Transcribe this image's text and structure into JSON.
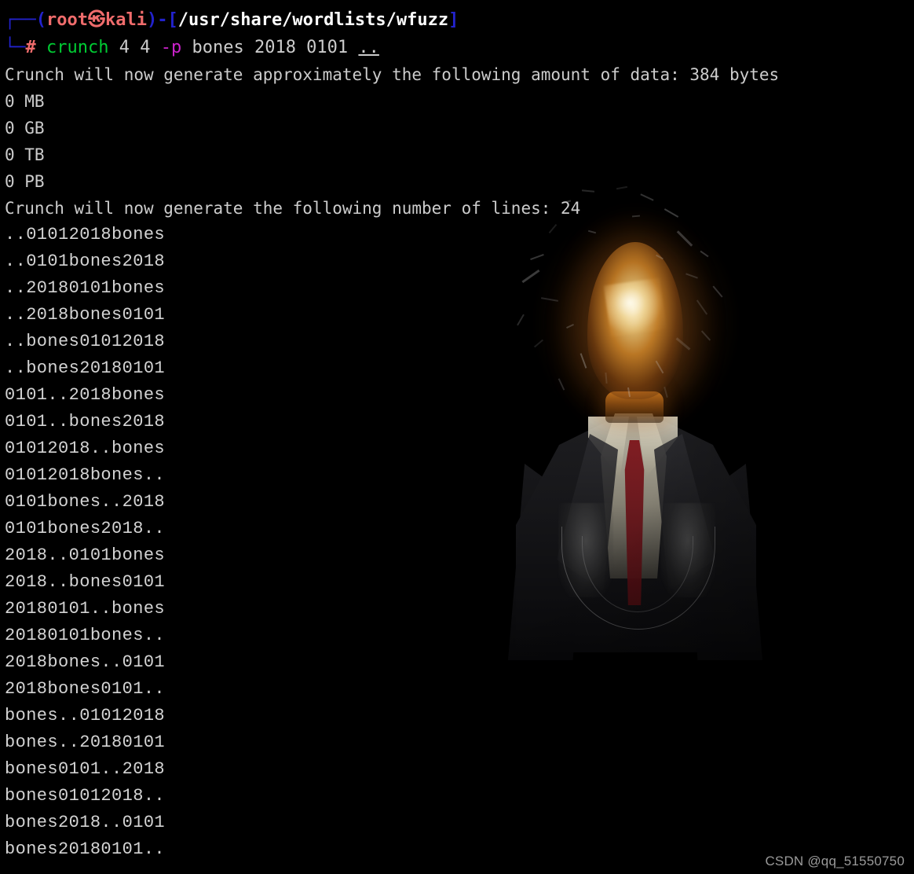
{
  "terminal": {
    "shell": "zsh",
    "background_color": "#000000",
    "foreground_color": "#cccccc",
    "prompt": {
      "top_box": "┌──",
      "bottom_box": "└─",
      "paren_open": "(",
      "user": "root",
      "at_symbol": "㉿",
      "host": "kali",
      "paren_close": ")",
      "dash": "-",
      "bracket_open": "[",
      "path": "/usr/share/wordlists/wfuzz",
      "bracket_close": "]",
      "hash": "#",
      "colors": {
        "box": "#2222cc",
        "user_host": "#f06c6c",
        "brackets": "#2222cc",
        "path": "#ffffff",
        "hash": "#f06c6c",
        "command": "#00cc33",
        "flag": "#cc22cc",
        "args": "#cccccc"
      }
    },
    "command": {
      "name": "crunch",
      "arg_min": "4",
      "arg_max": "4",
      "flag": "-p",
      "pattern_args": "bones 2018 0101",
      "trailing_path": ".."
    },
    "output": {
      "messages": [
        "Crunch will now generate approximately the following amount of data: 384 bytes",
        "0 MB",
        "0 GB",
        "0 TB",
        "0 PB",
        "Crunch will now generate the following number of lines: 24"
      ],
      "data_amount_bytes": "384",
      "line_count": "24",
      "words": [
        "..01012018bones",
        "..0101bones2018",
        "..20180101bones",
        "..2018bones0101",
        "..bones01012018",
        "..bones20180101",
        "0101..2018bones",
        "0101..bones2018",
        "01012018..bones",
        "01012018bones..",
        "0101bones..2018",
        "0101bones2018..",
        "2018..0101bones",
        "2018..bones0101",
        "20180101..bones",
        "20180101bones..",
        "2018bones..0101",
        "2018bones0101..",
        "bones..01012018",
        "bones..20180101",
        "bones0101..2018",
        "bones01012018..",
        "bones2018..0101",
        "bones20180101.."
      ]
    }
  },
  "wallpaper": {
    "description": "Dark wallpaper: suited figure whose head is a shattering glowing lightbulb",
    "glow_color": "#e8962c",
    "tie_color": "#7e161c",
    "suit_color": "#1f1f22",
    "shirt_color": "#d6d0bc"
  },
  "watermark": {
    "text": "CSDN @qq_51550750"
  }
}
